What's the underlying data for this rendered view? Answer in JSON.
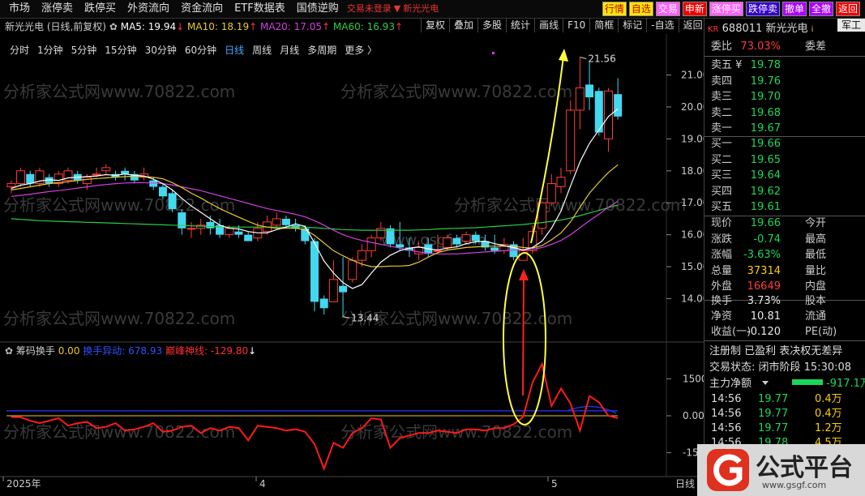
{
  "menu": {
    "items": [
      "市场",
      "涨停卖",
      "跌停买",
      "外资流向",
      "资金流向",
      "ETF数据表",
      "国债逆购"
    ],
    "status_red": "交易未登录",
    "stock_red": "新光光电"
  },
  "right_buttons": [
    "行情",
    "自选",
    "交易",
    "申新",
    "涨停买",
    "跌停卖",
    "撤单",
    "全撤",
    "返回"
  ],
  "toolbar2": [
    "复权",
    "叠加",
    "多股",
    "统计",
    "画线",
    "F10",
    "简框",
    "标记",
    "-自选",
    "返回"
  ],
  "ma_line": {
    "title": "新光光电 (日线,前复权)",
    "ma5": "MA5: 19.94",
    "ma10": "MA10: 18.19",
    "ma20": "MA20: 17.05",
    "ma60": "MA60: 16.93"
  },
  "periods": [
    "分时",
    "1分钟",
    "5分钟",
    "15分钟",
    "30分钟",
    "60分钟",
    "日线",
    "周线",
    "月线",
    "多周期",
    "更多 〉"
  ],
  "active_period": "日线",
  "price_axis": [
    "21.00",
    "20.00",
    "19.00",
    "18.00",
    "17.00",
    "16.00",
    "15.00",
    "14.00"
  ],
  "price_high_label": "21.56",
  "price_low_label": "13.44",
  "date_labels": [
    "2025年",
    "4",
    "5"
  ],
  "date_right_label": "日线",
  "watermark": "分析家公式网www.70822.com",
  "watermark_mid": "www.gsgf.com",
  "indicator": {
    "name": "筹码换手",
    "v1": "0.00",
    "v2": "换手异动: 678.93",
    "v3": "巅峰神线: -129.80",
    "axis": [
      "1500",
      "0.00",
      "-1500"
    ]
  },
  "quote": {
    "code": "688011",
    "name": "新光光电",
    "tag_kr": "KR",
    "tag_right": "军工",
    "wb_label": "委比",
    "wb_value": "73.03%",
    "wc_label": "委差",
    "asks": [
      {
        "label": "卖五",
        "mark": "¥",
        "price": "19.78"
      },
      {
        "label": "卖四",
        "price": "19.76"
      },
      {
        "label": "卖三",
        "price": "19.70"
      },
      {
        "label": "卖二",
        "price": "19.68"
      },
      {
        "label": "卖一",
        "price": "19.67"
      }
    ],
    "bids": [
      {
        "label": "买一",
        "price": "19.66"
      },
      {
        "label": "买二",
        "price": "19.65"
      },
      {
        "label": "买三",
        "price": "19.64"
      },
      {
        "label": "买四",
        "price": "19.62"
      },
      {
        "label": "买五",
        "price": "19.61"
      }
    ],
    "stats": [
      {
        "k": "现价",
        "v": "19.66",
        "k2": "今开",
        "cls": "g"
      },
      {
        "k": "涨跌",
        "v": "-0.74",
        "k2": "最高",
        "cls": "g"
      },
      {
        "k": "涨幅",
        "v": "-3.63%",
        "k2": "最低",
        "cls": "g"
      },
      {
        "k": "总量",
        "v": "37314",
        "k2": "量比",
        "cls": "y"
      },
      {
        "k": "外盘",
        "v": "16649",
        "k2": "内盘",
        "cls": "r"
      }
    ],
    "stats2": [
      {
        "k": "换手",
        "v": "3.73%",
        "k2": "股本",
        "cls": "w"
      },
      {
        "k": "净资",
        "v": "10.81",
        "k2": "流通",
        "cls": "w"
      },
      {
        "k": "收益(一)",
        "v": "-0.120",
        "k2": "PE(动)",
        "cls": "w"
      }
    ],
    "flags": "注册制 已盈利 表决权无差异",
    "trade_status": "交易状态: 闭市阶段 15:30:08",
    "net_label": "主力净额",
    "net_value": "-917.1万",
    "ticks": [
      {
        "t": "14:56",
        "p": "19.77",
        "v": "0.4万"
      },
      {
        "t": "14:56",
        "p": "19.77",
        "v": "0.4万"
      },
      {
        "t": "14:56",
        "p": "19.77",
        "v": "1.2万"
      },
      {
        "t": "14:56",
        "p": "19.78",
        "v": "4.5万"
      }
    ]
  },
  "logo_text": "公式平台",
  "logo_sub": "www.gsgf.com",
  "chart_data": {
    "type": "candlestick",
    "ylim": [
      13.2,
      21.8
    ],
    "candles": [
      [
        17.5,
        17.6,
        17.3,
        17.7
      ],
      [
        17.6,
        18.0,
        17.5,
        18.1
      ],
      [
        17.9,
        17.6,
        17.5,
        18.0
      ],
      [
        17.6,
        18.0,
        17.5,
        18.1
      ],
      [
        17.8,
        17.6,
        17.5,
        17.9
      ],
      [
        17.6,
        17.9,
        17.5,
        18.0
      ],
      [
        17.7,
        18.0,
        17.6,
        18.1
      ],
      [
        17.9,
        17.7,
        17.6,
        18.0
      ],
      [
        17.6,
        17.8,
        17.4,
        17.9
      ],
      [
        17.9,
        17.9,
        17.8,
        18.1
      ],
      [
        18.0,
        18.1,
        17.9,
        18.2
      ],
      [
        17.9,
        17.8,
        17.7,
        18.0
      ],
      [
        18.0,
        17.9,
        17.7,
        18.1
      ],
      [
        17.9,
        17.7,
        17.6,
        18.0
      ],
      [
        17.8,
        17.9,
        17.7,
        18.1
      ],
      [
        17.7,
        17.5,
        17.4,
        17.8
      ],
      [
        17.5,
        17.2,
        17.1,
        17.6
      ],
      [
        17.3,
        16.8,
        16.7,
        17.4
      ],
      [
        16.7,
        16.2,
        16.0,
        16.8
      ],
      [
        16.2,
        16.2,
        15.9,
        16.4
      ],
      [
        16.2,
        16.3,
        16.0,
        16.5
      ],
      [
        16.4,
        16.2,
        16.0,
        16.6
      ],
      [
        16.3,
        16.0,
        15.9,
        16.5
      ],
      [
        16.0,
        16.2,
        15.9,
        16.3
      ],
      [
        16.1,
        16.0,
        15.9,
        16.3
      ],
      [
        16.0,
        15.8,
        15.8,
        16.1
      ],
      [
        15.9,
        16.2,
        15.8,
        16.4
      ],
      [
        16.1,
        16.4,
        16.0,
        16.6
      ],
      [
        16.3,
        16.5,
        16.2,
        16.7
      ],
      [
        16.5,
        16.3,
        16.2,
        16.6
      ],
      [
        16.3,
        16.2,
        16.1,
        16.5
      ],
      [
        16.2,
        15.8,
        15.7,
        16.3
      ],
      [
        15.8,
        13.9,
        13.6,
        15.9
      ],
      [
        14.0,
        13.7,
        13.5,
        14.1
      ],
      [
        13.9,
        14.6,
        13.9,
        15.2
      ],
      [
        14.4,
        14.2,
        13.44,
        15.3
      ],
      [
        14.6,
        15.2,
        14.5,
        15.3
      ],
      [
        15.2,
        15.5,
        15.0,
        15.7
      ],
      [
        15.5,
        15.9,
        15.3,
        16.0
      ],
      [
        15.9,
        16.2,
        15.8,
        16.4
      ],
      [
        16.2,
        15.7,
        15.6,
        16.3
      ],
      [
        15.7,
        15.6,
        15.5,
        16.4
      ],
      [
        15.6,
        15.5,
        15.3,
        15.9
      ],
      [
        15.4,
        15.6,
        15.2,
        15.8
      ],
      [
        15.7,
        15.4,
        15.3,
        15.9
      ],
      [
        15.5,
        15.5,
        15.4,
        16.0
      ],
      [
        15.6,
        15.9,
        15.5,
        16.0
      ],
      [
        15.9,
        15.7,
        15.6,
        16.0
      ],
      [
        15.8,
        16.0,
        15.7,
        16.1
      ],
      [
        16.0,
        15.8,
        15.7,
        16.1
      ],
      [
        15.8,
        15.6,
        15.5,
        16.0
      ],
      [
        15.6,
        15.5,
        15.4,
        16.0
      ],
      [
        15.5,
        15.7,
        15.4,
        15.9
      ],
      [
        15.7,
        15.3,
        15.2,
        15.8
      ],
      [
        15.2,
        15.5,
        15.2,
        15.9
      ],
      [
        15.5,
        16.1,
        15.4,
        16.3
      ],
      [
        16.2,
        17.0,
        16.0,
        17.0
      ],
      [
        17.0,
        17.6,
        16.9,
        17.9
      ],
      [
        17.5,
        17.8,
        17.3,
        18.1
      ],
      [
        18.0,
        19.9,
        17.9,
        20.2
      ],
      [
        19.9,
        20.6,
        19.3,
        21.56
      ],
      [
        20.7,
        20.3,
        19.9,
        21.4
      ],
      [
        20.5,
        19.2,
        19.1,
        20.6
      ],
      [
        19.0,
        20.5,
        18.6,
        20.6
      ],
      [
        20.4,
        19.7,
        19.6,
        20.9
      ]
    ],
    "ma5": [
      17.45,
      17.55,
      17.6,
      17.68,
      17.72,
      17.7,
      17.78,
      17.8,
      17.82,
      17.84,
      17.88,
      17.86,
      17.9,
      17.86,
      17.84,
      17.74,
      17.6,
      17.4,
      17.14,
      16.9,
      16.7,
      16.5,
      16.3,
      16.2,
      16.18,
      16.1,
      16.06,
      16.06,
      16.16,
      16.24,
      16.34,
      16.26,
      15.74,
      15.18,
      14.8,
      14.5,
      14.32,
      14.44,
      14.8,
      15.14,
      15.36,
      15.5,
      15.58,
      15.62,
      15.56,
      15.52,
      15.58,
      15.62,
      15.72,
      15.78,
      15.8,
      15.72,
      15.66,
      15.6,
      15.52,
      15.6,
      15.8,
      16.2,
      16.74,
      17.52,
      18.28,
      18.86,
      19.28,
      19.7,
      19.94
    ],
    "ma10": [
      17.4,
      17.45,
      17.5,
      17.55,
      17.6,
      17.63,
      17.66,
      17.7,
      17.73,
      17.76,
      17.78,
      17.8,
      17.82,
      17.83,
      17.82,
      17.8,
      17.75,
      17.63,
      17.48,
      17.3,
      17.15,
      16.98,
      16.82,
      16.68,
      16.55,
      16.42,
      16.3,
      16.24,
      16.2,
      16.2,
      16.2,
      16.16,
      15.98,
      15.74,
      15.5,
      15.34,
      15.2,
      15.08,
      15.0,
      15.0,
      15.02,
      15.02,
      15.04,
      15.14,
      15.3,
      15.44,
      15.52,
      15.56,
      15.6,
      15.62,
      15.64,
      15.64,
      15.64,
      15.64,
      15.6,
      15.58,
      15.66,
      15.84,
      16.06,
      16.4,
      16.86,
      17.3,
      17.64,
      17.95,
      18.19
    ],
    "ma20": [
      17.2,
      17.23,
      17.27,
      17.31,
      17.35,
      17.38,
      17.42,
      17.46,
      17.5,
      17.54,
      17.57,
      17.6,
      17.62,
      17.63,
      17.63,
      17.62,
      17.6,
      17.56,
      17.5,
      17.44,
      17.38,
      17.3,
      17.22,
      17.14,
      17.06,
      16.98,
      16.9,
      16.82,
      16.76,
      16.7,
      16.64,
      16.56,
      16.44,
      16.3,
      16.14,
      16.0,
      15.9,
      15.82,
      15.76,
      15.7,
      15.64,
      15.58,
      15.52,
      15.46,
      15.42,
      15.4,
      15.4,
      15.4,
      15.42,
      15.44,
      15.46,
      15.48,
      15.5,
      15.52,
      15.52,
      15.54,
      15.6,
      15.7,
      15.82,
      16.0,
      16.22,
      16.44,
      16.64,
      16.86,
      17.05
    ],
    "ma60": [
      16.5,
      16.48,
      16.46,
      16.44,
      16.43,
      16.42,
      16.41,
      16.4,
      16.39,
      16.38,
      16.37,
      16.36,
      16.35,
      16.34,
      16.33,
      16.32,
      16.31,
      16.3,
      16.29,
      16.28,
      16.27,
      16.26,
      16.25,
      16.24,
      16.24,
      16.24,
      16.24,
      16.24,
      16.24,
      16.24,
      16.24,
      16.24,
      16.22,
      16.2,
      16.18,
      16.16,
      16.15,
      16.14,
      16.14,
      16.14,
      16.14,
      16.14,
      16.14,
      16.15,
      16.16,
      16.18,
      16.19,
      16.2,
      16.21,
      16.22,
      16.24,
      16.26,
      16.28,
      16.3,
      16.32,
      16.35,
      16.38,
      16.42,
      16.46,
      16.52,
      16.6,
      16.68,
      16.76,
      16.85,
      16.93
    ],
    "indicator_line": [
      -50,
      -60,
      -200,
      -300,
      -200,
      -100,
      -400,
      -300,
      -250,
      -500,
      -450,
      -300,
      -600,
      -550,
      -450,
      -300,
      -650,
      -600,
      -450,
      -400,
      -700,
      -500,
      -600,
      -450,
      -500,
      -1000,
      -400,
      -450,
      -500,
      -600,
      -550,
      -650,
      -1150,
      -2150,
      -1100,
      -1300,
      -700,
      -500,
      -100,
      -150,
      -1300,
      -900,
      -800,
      -700,
      -700,
      -600,
      -650,
      -700,
      -550,
      -550,
      -600,
      -500,
      -500,
      -350,
      -50,
      1350,
      2100,
      400,
      1100,
      500,
      -600,
      800,
      550,
      0,
      -100
    ],
    "indicator_ylim": [
      -2400,
      2400
    ]
  }
}
